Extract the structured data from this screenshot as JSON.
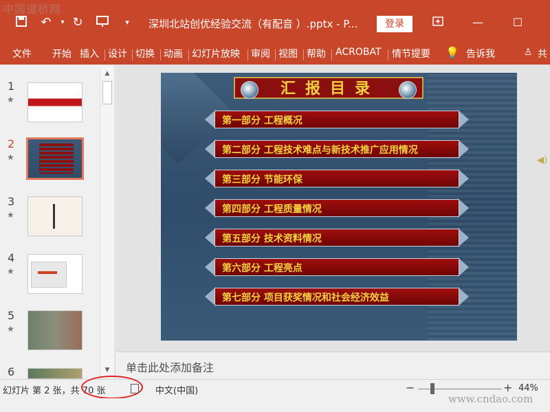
{
  "watermarks": {
    "top": "中国道桥网",
    "bottom": "www.cndao.com"
  },
  "titlebar": {
    "title": "深圳北站创优经验交流（有配音 ）.pptx  -  P...",
    "login_label": "登录",
    "icons": [
      "save-icon",
      "undo-icon",
      "redo-icon",
      "slideshow-icon",
      "customize-icon",
      "restore-icon",
      "maximize-icon"
    ]
  },
  "ribbon": {
    "tabs": [
      "文件",
      "开始",
      "插入",
      "设计",
      "切换",
      "动画",
      "幻灯片放映",
      "审阅",
      "视图",
      "帮助",
      "ACROBAT",
      "情节提要"
    ],
    "tell_me": "告诉我",
    "share": "共"
  },
  "thumbnails": [
    {
      "num": "1",
      "star": "★"
    },
    {
      "num": "2",
      "star": "★"
    },
    {
      "num": "3",
      "star": "★"
    },
    {
      "num": "4",
      "star": "★"
    },
    {
      "num": "5",
      "star": "★"
    },
    {
      "num": "6",
      "star": ""
    }
  ],
  "slide": {
    "title": "汇报目录",
    "items": [
      "第一部分    工程概况",
      "第二部分    工程技术难点与新技术推广应用情况",
      "第三部分    节能环保",
      "第四部分    工程质量情况",
      "第五部分    技术资料情况",
      "第六部分    工程亮点",
      "第七部分    项目获奖情况和社会经济效益"
    ]
  },
  "notes": {
    "placeholder": "单击此处添加备注"
  },
  "statusbar": {
    "slide_info": "幻灯片 第 2 张，共 70 张",
    "language": "中文(中国)",
    "zoom": "44%"
  },
  "colors": {
    "accent": "#c8472a",
    "slide_bg": "#2f4d6a",
    "item_red": "#8b0f0f",
    "item_text": "#f2d040"
  }
}
